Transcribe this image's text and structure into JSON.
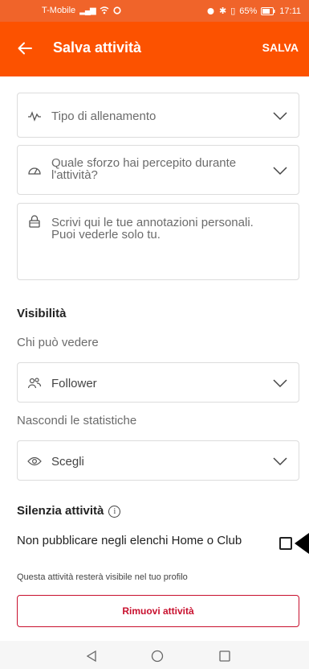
{
  "status_bar": {
    "carrier": "T-Mobile",
    "battery": "65%",
    "time": "17:11"
  },
  "app_bar": {
    "title": "Salva attività",
    "save_label": "SALVA"
  },
  "form": {
    "workout_type": {
      "placeholder": "Tipo di allenamento",
      "icon": "heart-rate-icon"
    },
    "effort": {
      "placeholder": "Quale sforzo hai percepito durante l'attività?",
      "icon": "gauge-icon"
    },
    "notes": {
      "placeholder": "Scrivi qui le tue annotazioni personali. Puoi vederle solo tu.",
      "icon": "lock-icon"
    }
  },
  "visibility": {
    "title": "Visibilità",
    "who_can_see_label": "Chi può vedere",
    "who_can_see_value": "Follower",
    "hide_stats_label": "Nascondi le statistiche",
    "hide_stats_value": "Scegli"
  },
  "mute": {
    "title": "Silenzia attività",
    "option_label": "Non pubblicare negli elenchi Home o Club",
    "checked": false,
    "note": "Questa attività resterà visibile nel tuo profilo"
  },
  "remove_label": "Rimuovi attività",
  "colors": {
    "brand": "#fc5200",
    "danger": "#c8102e"
  }
}
